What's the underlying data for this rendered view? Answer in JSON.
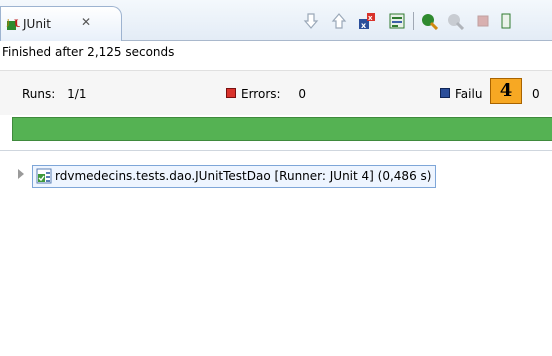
{
  "tab": {
    "label": "JUnit",
    "close_glyph": "✕",
    "icon": "junit-tab-icon"
  },
  "toolbar": {
    "icons": [
      "next-failure-icon",
      "previous-failure-icon",
      "show-failures-only-icon",
      "scroll-lock-icon",
      "rerun-test-icon",
      "rerun-failed-first-icon",
      "stop-icon",
      "history-icon"
    ]
  },
  "status": {
    "text": "Finished after 2,125 seconds"
  },
  "counters": {
    "runs_label": "Runs:",
    "runs_value": "1/1",
    "errors_label": "Errors:",
    "errors_value": "0",
    "failures_label": "Failu",
    "failures_value": "0"
  },
  "progress": {
    "fraction": 1.0,
    "color": "#55b253"
  },
  "callout": {
    "label": "4"
  },
  "tree": {
    "item_label": "rdvmedecins.tests.dao.JUnitTestDao [Runner: JUnit 4] (0,486 s)",
    "icon": "test-suite-ok-icon"
  },
  "colors": {
    "error": "#d9322b",
    "failure": "#2a4e9a",
    "accent": "#f7a823"
  }
}
